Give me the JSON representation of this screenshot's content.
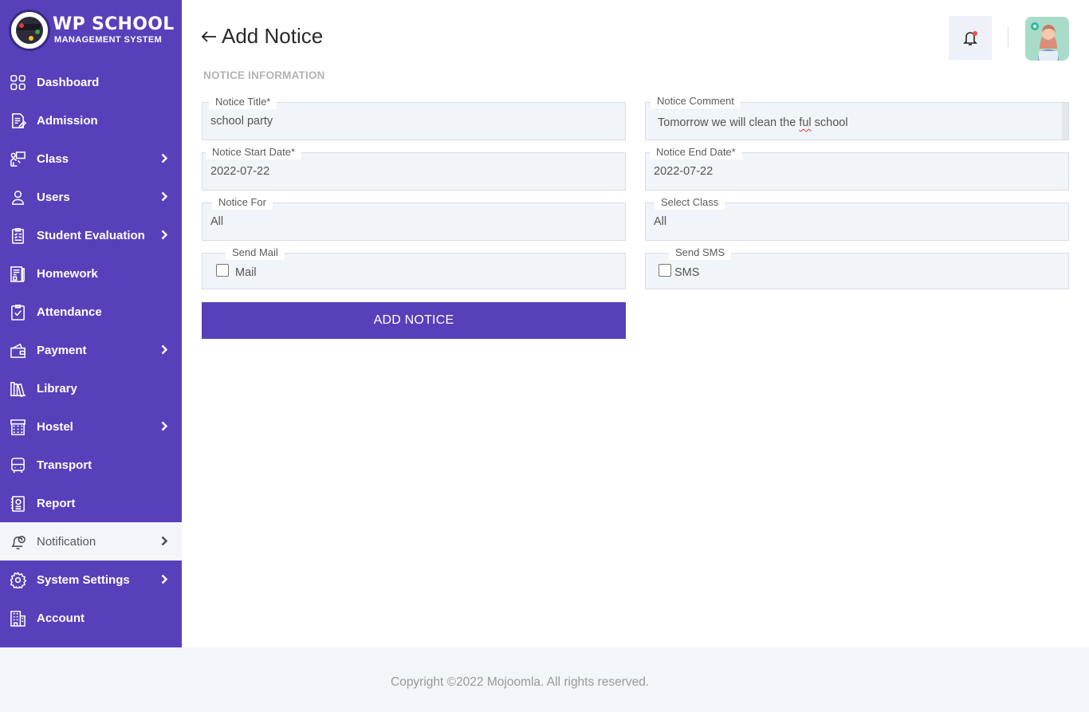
{
  "brand": {
    "title": "WP SCHOOL",
    "subtitle": "MANAGEMENT SYSTEM"
  },
  "sidebar": {
    "items": [
      {
        "label": "Dashboard",
        "icon": "dashboard-grid-icon",
        "has_submenu": false,
        "active": false
      },
      {
        "label": "Admission",
        "icon": "admission-form-icon",
        "has_submenu": false,
        "active": false
      },
      {
        "label": "Class",
        "icon": "class-teacher-icon",
        "has_submenu": true,
        "active": false
      },
      {
        "label": "Users",
        "icon": "user-icon",
        "has_submenu": true,
        "active": false
      },
      {
        "label": "Student Evaluation",
        "icon": "evaluation-clipboard-icon",
        "has_submenu": true,
        "active": false
      },
      {
        "label": "Homework",
        "icon": "homework-icon",
        "has_submenu": false,
        "active": false
      },
      {
        "label": "Attendance",
        "icon": "attendance-check-icon",
        "has_submenu": false,
        "active": false
      },
      {
        "label": "Payment",
        "icon": "wallet-icon",
        "has_submenu": true,
        "active": false
      },
      {
        "label": "Library",
        "icon": "library-books-icon",
        "has_submenu": false,
        "active": false
      },
      {
        "label": "Hostel",
        "icon": "hostel-building-icon",
        "has_submenu": true,
        "active": false
      },
      {
        "label": "Transport",
        "icon": "bus-icon",
        "has_submenu": false,
        "active": false
      },
      {
        "label": "Report",
        "icon": "report-icon",
        "has_submenu": false,
        "active": false
      },
      {
        "label": "Notification",
        "icon": "notification-bell-icon",
        "has_submenu": true,
        "active": true
      },
      {
        "label": "System Settings",
        "icon": "gear-icon",
        "has_submenu": true,
        "active": false
      },
      {
        "label": "Account",
        "icon": "account-building-icon",
        "has_submenu": false,
        "active": false
      }
    ]
  },
  "header": {
    "title": "Add Notice",
    "back_icon": "arrow-left-icon",
    "bell_icon": "bell-icon"
  },
  "form": {
    "section_title": "NOTICE INFORMATION",
    "notice_title": {
      "label": "Notice Title*",
      "value": "school party"
    },
    "notice_comment": {
      "label": "Notice Comment",
      "value_before": "Tomorrow we will clean the ",
      "value_misspelled": "ful",
      "value_after": " school"
    },
    "start_date": {
      "label": "Notice Start Date*",
      "value": "2022-07-22"
    },
    "end_date": {
      "label": "Notice End Date*",
      "value": "2022-07-22"
    },
    "notice_for": {
      "label": "Notice For",
      "value": "All"
    },
    "select_class": {
      "label": "Select Class",
      "value": "All"
    },
    "send_mail": {
      "label": "Send Mail",
      "option": "Mail",
      "checked": false
    },
    "send_sms": {
      "label": "Send SMS",
      "option": "SMS",
      "checked": false
    },
    "submit_label": "ADD NOTICE"
  },
  "colors": {
    "primary": "#5840bb",
    "field_bg": "#f1f4f8",
    "footer_bg": "#f2f5fa",
    "notification_dot": "#f2524a"
  },
  "footer": {
    "copyright": "Copyright ©2022 Mojoomla. All rights reserved."
  }
}
